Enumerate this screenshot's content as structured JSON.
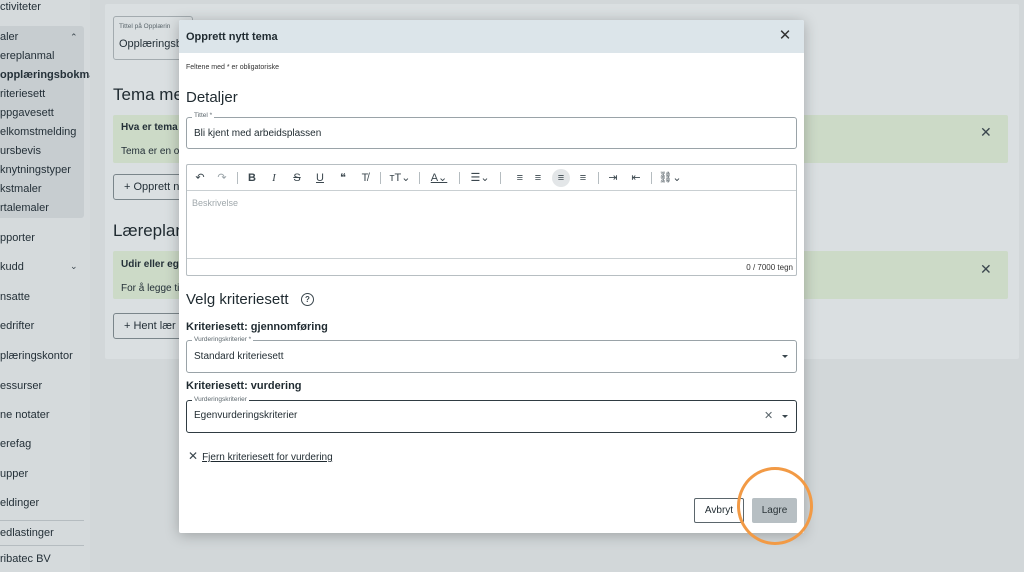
{
  "sidebar": {
    "items": [
      {
        "label": "ctiviteter"
      },
      {
        "label": "aler"
      },
      {
        "label": "ereplanmal"
      },
      {
        "label": "opplæringsbokmal"
      },
      {
        "label": "riteriesett"
      },
      {
        "label": "ppgavesett"
      },
      {
        "label": "elkomstmelding"
      },
      {
        "label": "ursbevis"
      },
      {
        "label": "knytningstyper"
      },
      {
        "label": "kstmaler"
      },
      {
        "label": "rtalemaler"
      },
      {
        "label": "pporter"
      },
      {
        "label": "kudd"
      },
      {
        "label": "nsatte"
      },
      {
        "label": "edrifter"
      },
      {
        "label": "plæringskontor"
      },
      {
        "label": "essurser"
      },
      {
        "label": "ne notater"
      },
      {
        "label": "erefag"
      },
      {
        "label": "upper"
      },
      {
        "label": "eldinger"
      },
      {
        "label": "edlastinger"
      },
      {
        "label": "ribatec BV"
      }
    ]
  },
  "background": {
    "title_field_label": "Tittel på Opplærin",
    "title_field_value": "Opplæringsb",
    "section1_heading": "Tema med",
    "alert1_title": "Hva er tema",
    "alert1_text": "Tema er en o",
    "button1_label": "Opprett n",
    "section2_heading": "Læreplane",
    "alert2_title": "Udir eller eg",
    "alert2_text": "For å legge ti",
    "button2_label": "Hent lær",
    "close_glyph": "✕"
  },
  "modal": {
    "title": "Opprett nytt tema",
    "close_glyph": "✕",
    "required_note": "Feltene med * er obligatoriske",
    "details_heading": "Detaljer",
    "title_field": {
      "label": "Tittel *",
      "value": "Bli kjent med arbeidsplassen"
    },
    "editor": {
      "toolbar": [
        {
          "name": "undo-icon",
          "glyph": "↶"
        },
        {
          "name": "redo-icon",
          "glyph": "↷"
        },
        {
          "name": "bold-icon",
          "glyph": "B"
        },
        {
          "name": "italic-icon",
          "glyph": "I"
        },
        {
          "name": "strikethrough-icon",
          "glyph": "S"
        },
        {
          "name": "underline-icon",
          "glyph": "U"
        },
        {
          "name": "quote-icon",
          "glyph": "❝"
        },
        {
          "name": "clear-format-icon",
          "glyph": "T̸"
        },
        {
          "name": "font-size-icon",
          "glyph": "тT⌄"
        },
        {
          "name": "font-color-icon",
          "glyph": "A⌄"
        },
        {
          "name": "list-icon",
          "glyph": "☰⌄"
        },
        {
          "name": "align-right-icon",
          "glyph": "≡"
        },
        {
          "name": "align-center-icon",
          "glyph": "≡"
        },
        {
          "name": "align-left-icon",
          "glyph": "≡"
        },
        {
          "name": "align-justify-icon",
          "glyph": "≡"
        },
        {
          "name": "indent-icon",
          "glyph": "⇥"
        },
        {
          "name": "outdent-icon",
          "glyph": "⇤"
        },
        {
          "name": "link-icon",
          "glyph": "⛓⌄"
        }
      ],
      "placeholder": "Beskrivelse",
      "char_count": "0 / 7000 tegn"
    },
    "criteria_heading": "Velg kriteriesett",
    "help_glyph": "?",
    "execution": {
      "heading": "Kriteriesett: gjennomføring",
      "label": "Vurderingskriterier *",
      "value": "Standard kriteriesett"
    },
    "assessment": {
      "heading": "Kriteriesett: vurdering",
      "label": "Vurderingskriterier",
      "value": "Egenvurderingskriterier",
      "clear_glyph": "✕"
    },
    "remove_link": {
      "glyph": "✕",
      "label": "Fjern kriteriesett for vurdering"
    },
    "cancel_label": "Avbryt",
    "save_label": "Lagre"
  },
  "colors": {
    "header": "#dce5ea",
    "highlight_ring": "#f29a45",
    "save_button": "#b7bfc3"
  }
}
